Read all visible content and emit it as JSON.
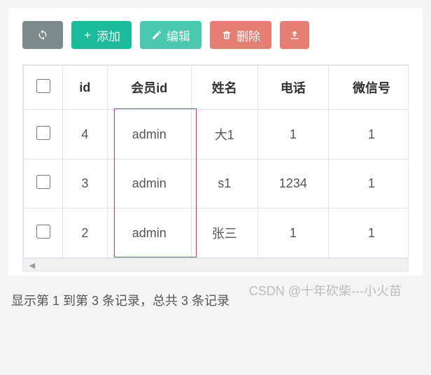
{
  "toolbar": {
    "refresh_label": "",
    "add_label": "添加",
    "edit_label": "编辑",
    "delete_label": "删除",
    "upload_label": ""
  },
  "table": {
    "headers": {
      "id": "id",
      "member_id": "会员id",
      "name": "姓名",
      "phone": "电话",
      "wechat": "微信号"
    },
    "rows": [
      {
        "id": "4",
        "member_id": "admin",
        "name": "大1",
        "phone": "1",
        "wechat": "1"
      },
      {
        "id": "3",
        "member_id": "admin",
        "name": "s1",
        "phone": "1234",
        "wechat": "1"
      },
      {
        "id": "2",
        "member_id": "admin",
        "name": "张三",
        "phone": "1",
        "wechat": "1"
      }
    ]
  },
  "footer": {
    "text": "显示第 1 到第 3 条记录，总共 3 条记录"
  },
  "watermark": "CSDN @十年砍柴---小火苗"
}
